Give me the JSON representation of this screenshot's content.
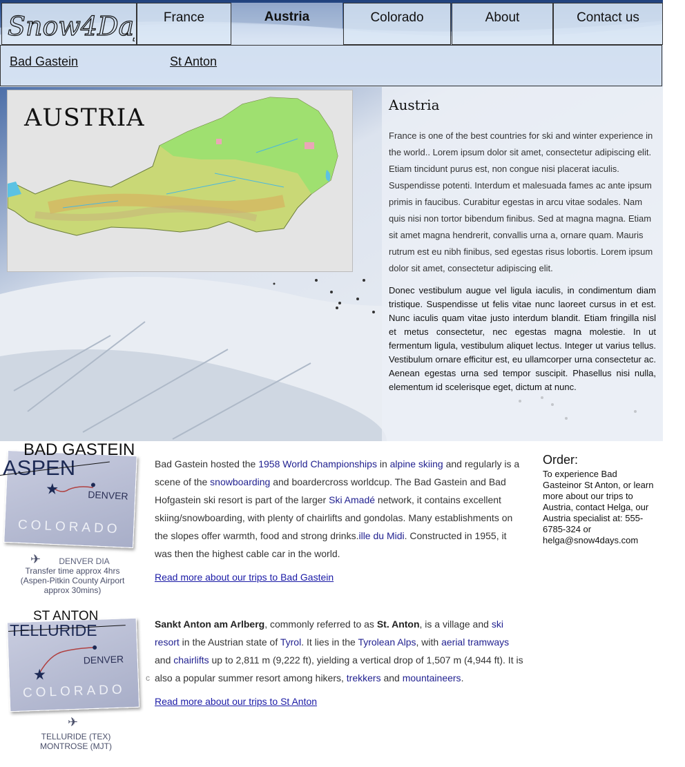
{
  "nav": {
    "logo": "Snow4Days",
    "tabs": [
      {
        "label": "France"
      },
      {
        "label": "Austria"
      },
      {
        "label": "Colorado"
      },
      {
        "label": "About"
      },
      {
        "label": "Contact us"
      }
    ],
    "subnav": [
      "Bad Gastein",
      "St Anton"
    ]
  },
  "hero": {
    "map_title": "AUSTRIA",
    "panel_title": "Austria",
    "para1": "France is one of the best countries for ski and winter experience in the world.. Lorem ipsum dolor sit amet, consectetur adipiscing elit. Etiam tincidunt purus est, non congue nisi placerat iaculis. Suspendisse potenti. Interdum et malesuada fames ac ante ipsum primis in faucibus. Curabitur egestas in arcu vitae sodales. Nam quis nisi non tortor bibendum finibus. Sed at magna magna. Etiam sit amet magna hendrerit, convallis urna a, ornare quam. Mauris rutrum est eu nibh finibus, sed egestas risus lobortis. Lorem ipsum dolor sit amet, consectetur adipiscing elit.",
    "para2": "Donec vestibulum augue vel ligula iaculis, in condimentum diam tristique. Suspendisse ut felis vitae nunc laoreet cursus in et est. Nunc iaculis quam vitae justo interdum blandit. Etiam fringilla nisl et metus consectetur, nec egestas magna molestie. In ut fermentum ligula, vestibulum aliquet lectus. Integer ut varius tellus. Vestibulum ornare efficitur est, eu ullamcorper urna consectetur ac. Aenean egestas urna sed tempor suscipit. Phasellus nisi nulla, elementum id scelerisque eget, dictum at nunc."
  },
  "destinations": [
    {
      "title": "BAD GASTEIN",
      "map_old_name": "ASPEN",
      "map_denver": "DENVER",
      "map_state": "COLORADO",
      "airport_line1": "DENVER DIA",
      "airport_line2": "Transfer time approx 4hrs",
      "airport_line3": "(Aspen-Pitkin County Airport",
      "airport_line4": "approx 30mins)",
      "desc": {
        "t1": "Bad Gastein hosted the ",
        "l1": "1958 World Championships",
        "t2": " in ",
        "l2": "alpine skiing",
        "t3": " and regularly is a scene of the ",
        "l3": "snowboarding",
        "t4": " and boardercross worldcup. The Bad Gastein and Bad Hofgastein ski resort is part of the larger ",
        "l4": "Ski Amadé",
        "t5": " network, it contains excellent skiing/snowboarding, with plenty of chairlifts and gondolas. Many establishments on the slopes offer warmth, food and strong drinks.",
        "l5": "ille du Midi",
        "t6": ". Constructed in 1955, it was then the highest cable car in the world."
      },
      "read_more": "Read more about our trips to Bad Gastein"
    },
    {
      "title": "ST ANTON",
      "map_old_name": "TELLURIDE",
      "map_denver": "DENVER",
      "map_state": "COLORADO",
      "airport_line1": "TELLURIDE (TEX)",
      "airport_line2": "MONTROSE (MJT)",
      "desc": {
        "b1": "Sankt Anton am Arlberg",
        "t1": ", commonly referred to as ",
        "b2": "St. Anton",
        "t2": ", is a village and ",
        "l1": "ski resort",
        "t3": " in the Austrian state of ",
        "l2": "Tyrol",
        "t4": ". It lies in the ",
        "l3": "Tyrolean Alps",
        "t5": ", with ",
        "l4": "aerial tramways",
        "t6": " and ",
        "l5": "chairlifts",
        "t7": " up to 2,811 m (9,222 ft), yielding a vertical drop of 1,507 m (4,944 ft). It is also a popular summer resort among hikers, ",
        "l6": "trekkers",
        "t8": " and ",
        "l7": "mountaineers",
        "t9": "."
      },
      "read_more": "Read more about our trips to St Anton",
      "stray_char": "c"
    }
  ],
  "order": {
    "title": "Order:",
    "text": "To experience Bad Gasteinor St Anton, or learn more about our trips to Austria, contact Helga, our Austria specialist at: 555-6785-324 or helga@snow4days.com"
  }
}
